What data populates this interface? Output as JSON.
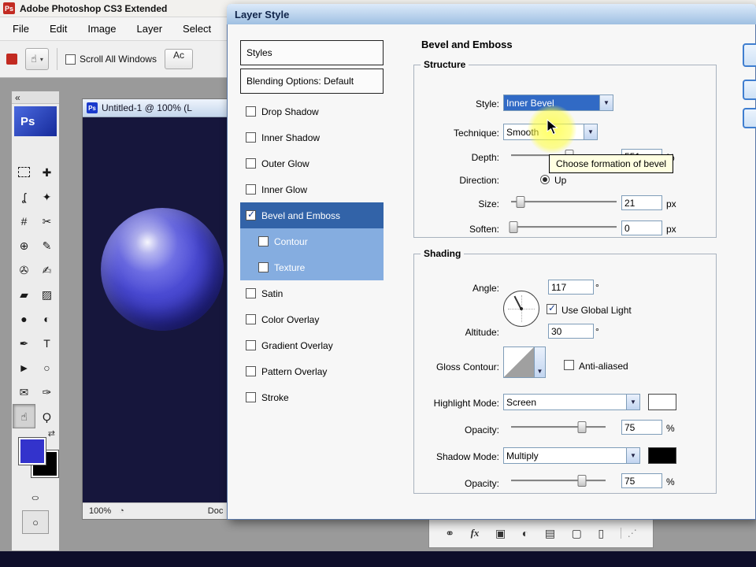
{
  "app": {
    "title": "Adobe Photoshop CS3 Extended",
    "app_icon": "Ps",
    "menu": [
      "File",
      "Edit",
      "Image",
      "Layer",
      "Select"
    ],
    "options_bar": {
      "hand_tool_glyph": "☝",
      "dropdown_caret": "▾",
      "scroll_all_windows_label": "Scroll All Windows",
      "scroll_all_windows_checked": false,
      "actual_pixels_label": "Ac"
    }
  },
  "toolbar": {
    "collapse_glyph": "«",
    "logo": "Ps",
    "tools": [
      {
        "name": "rectangular-marquee-tool",
        "glyph": "",
        "cls": "dashed"
      },
      {
        "name": "move-tool",
        "glyph": "✚"
      },
      {
        "name": "lasso-tool",
        "glyph": "ʆ"
      },
      {
        "name": "magic-wand-tool",
        "glyph": "✦"
      },
      {
        "name": "crop-tool",
        "glyph": "#"
      },
      {
        "name": "slice-tool",
        "glyph": "✂"
      },
      {
        "name": "healing-brush-tool",
        "glyph": "⊕"
      },
      {
        "name": "brush-tool",
        "glyph": "✎"
      },
      {
        "name": "clone-stamp-tool",
        "glyph": "✇"
      },
      {
        "name": "history-brush-tool",
        "glyph": "✍"
      },
      {
        "name": "eraser-tool",
        "glyph": "▰"
      },
      {
        "name": "gradient-tool",
        "glyph": "▨"
      },
      {
        "name": "blur-tool",
        "glyph": "●"
      },
      {
        "name": "dodge-tool",
        "glyph": "◐"
      },
      {
        "name": "pen-tool",
        "glyph": "✒"
      },
      {
        "name": "type-tool",
        "glyph": "T"
      },
      {
        "name": "path-selection-tool",
        "glyph": "►"
      },
      {
        "name": "ellipse-tool",
        "glyph": "○"
      },
      {
        "name": "notes-tool",
        "glyph": "✉"
      },
      {
        "name": "eyedropper-tool",
        "glyph": "✑"
      },
      {
        "name": "hand-tool",
        "glyph": "☝",
        "selected": true
      },
      {
        "name": "zoom-tool",
        "glyph": "Ϙ"
      }
    ],
    "swap_colors_glyph": "⇄",
    "quick_mask_glyph": "○",
    "screen_mode_glyph": "○",
    "foreground_color": "#3333cc",
    "background_color": "#000000"
  },
  "document": {
    "doc_icon": "Ps",
    "title": "Untitled-1 @ 100% (L",
    "zoom": "100%",
    "status_icon": "◔",
    "status": "Doc"
  },
  "layers_strip": {
    "icons": [
      {
        "name": "link-layers-icon",
        "glyph": "⚭"
      },
      {
        "name": "layer-style-fx-icon",
        "glyph": "fx"
      },
      {
        "name": "layer-mask-icon",
        "glyph": "▣"
      },
      {
        "name": "adjustment-layer-icon",
        "glyph": "◐"
      },
      {
        "name": "layer-group-icon",
        "glyph": "▤"
      },
      {
        "name": "new-layer-icon",
        "glyph": "▢"
      },
      {
        "name": "delete-layer-icon",
        "glyph": "▯"
      }
    ],
    "grip_glyph": "⋰"
  },
  "dialog": {
    "title": "Layer Style",
    "styles_panel": {
      "header": "Styles",
      "blending": "Blending Options: Default",
      "items": [
        {
          "label": "Drop Shadow",
          "checked": false
        },
        {
          "label": "Inner Shadow",
          "checked": false
        },
        {
          "label": "Outer Glow",
          "checked": false
        },
        {
          "label": "Inner Glow",
          "checked": false
        },
        {
          "label": "Bevel and Emboss",
          "checked": true,
          "selected": true
        },
        {
          "label": "Contour",
          "checked": false,
          "sub": true
        },
        {
          "label": "Texture",
          "checked": false,
          "sub": true
        },
        {
          "label": "Satin",
          "checked": false
        },
        {
          "label": "Color Overlay",
          "checked": false
        },
        {
          "label": "Gradient Overlay",
          "checked": false
        },
        {
          "label": "Pattern Overlay",
          "checked": false
        },
        {
          "label": "Stroke",
          "checked": false
        }
      ]
    },
    "panel_title": "Bevel and Emboss",
    "structure": {
      "legend": "Structure",
      "style_label": "Style:",
      "style_value": "Inner Bevel",
      "technique_label": "Technique:",
      "technique_value": "Smooth",
      "depth_label": "Depth:",
      "depth_value": "551",
      "depth_unit": "%",
      "direction_label": "Direction:",
      "direction_up_label": "Up",
      "direction_up_selected": true,
      "size_label": "Size:",
      "size_value": "21",
      "size_unit": "px",
      "soften_label": "Soften:",
      "soften_value": "0",
      "soften_unit": "px"
    },
    "tooltip": "Choose formation of bevel",
    "shading": {
      "legend": "Shading",
      "angle_label": "Angle:",
      "angle_value": "117",
      "angle_unit": "°",
      "use_global_light_label": "Use Global Light",
      "use_global_light_checked": true,
      "altitude_label": "Altitude:",
      "altitude_value": "30",
      "altitude_unit": "°",
      "gloss_contour_label": "Gloss Contour:",
      "anti_aliased_label": "Anti-aliased",
      "anti_aliased_checked": false,
      "highlight_mode_label": "Highlight Mode:",
      "highlight_mode_value": "Screen",
      "highlight_color": "#ffffff",
      "highlight_opacity_label": "Opacity:",
      "highlight_opacity_value": "75",
      "highlight_opacity_unit": "%",
      "shadow_mode_label": "Shadow Mode:",
      "shadow_mode_value": "Multiply",
      "shadow_color": "#000000",
      "shadow_opacity_label": "Opacity:",
      "shadow_opacity_value": "75",
      "shadow_opacity_unit": "%"
    }
  },
  "colors": {
    "selection_blue": "#316ac5",
    "sub_selection_blue": "#85ade0",
    "canvas_navy": "#16163c",
    "tooltip_bg": "#ffffe1",
    "cursor_highlight_yellow": "#ffff3c",
    "dialog_titlebar_blue": "#9fc0e2"
  }
}
